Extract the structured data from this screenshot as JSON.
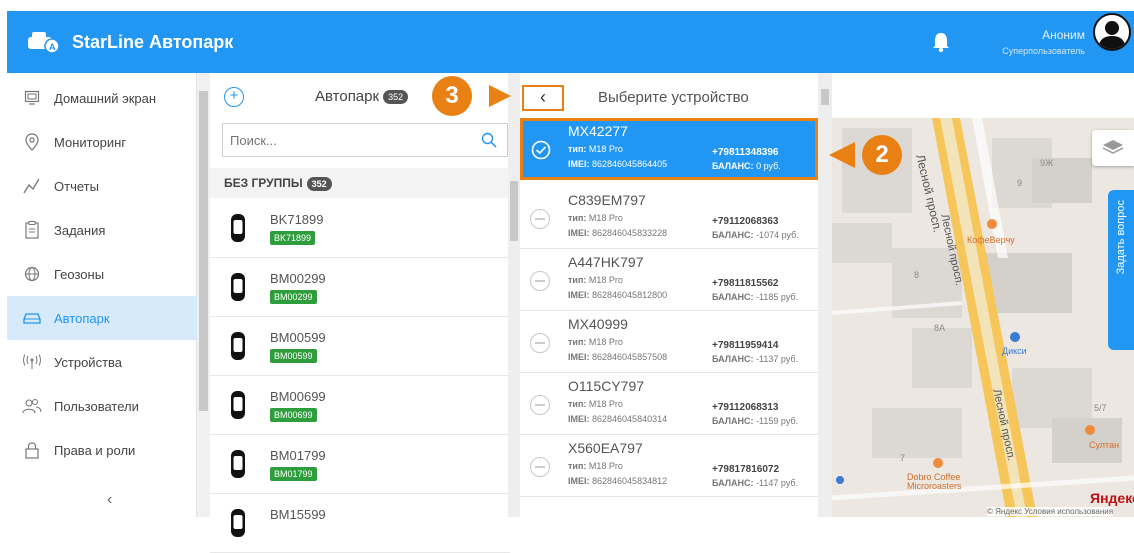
{
  "app": {
    "title": "StarLine Автопарк"
  },
  "user": {
    "name": "Аноним",
    "role": "Суперпользователь"
  },
  "sidebar": {
    "items": [
      {
        "label": "Домашний экран",
        "icon": "home-icon"
      },
      {
        "label": "Мониторинг",
        "icon": "location-pin-icon"
      },
      {
        "label": "Отчеты",
        "icon": "chart-icon"
      },
      {
        "label": "Задания",
        "icon": "clipboard-icon"
      },
      {
        "label": "Геозоны",
        "icon": "globe-icon"
      },
      {
        "label": "Автопарк",
        "icon": "car-icon",
        "active": true
      },
      {
        "label": "Устройства",
        "icon": "antenna-icon"
      },
      {
        "label": "Пользователи",
        "icon": "users-icon"
      },
      {
        "label": "Права и роли",
        "icon": "lock-icon"
      }
    ],
    "collapse_label": "‹"
  },
  "fleet": {
    "title": "Автопарк",
    "count": "352",
    "search_placeholder": "Поиск...",
    "group_label": "БЕЗ ГРУППЫ",
    "group_count": "352",
    "vehicles": [
      {
        "name": "BK71899",
        "plate": "BK71899"
      },
      {
        "name": "BM00299",
        "plate": "BM00299"
      },
      {
        "name": "BM00599",
        "plate": "BM00599"
      },
      {
        "name": "BM00699",
        "plate": "BM00699"
      },
      {
        "name": "BM01799",
        "plate": "BM01799"
      },
      {
        "name": "BM15599",
        "plate": ""
      }
    ]
  },
  "devices": {
    "title": "Выберите устройство",
    "back_label": "‹",
    "type_key": "тип:",
    "imei_key": "IMEI:",
    "balance_key": "БАЛАНС:",
    "list": [
      {
        "name": "MX42277",
        "type": "M18 Pro",
        "imei": "862846045864405",
        "phone": "+79811348396",
        "balance": "0 руб.",
        "selected": true
      },
      {
        "name": "C839EM797",
        "type": "M18 Pro",
        "imei": "862846045833228",
        "phone": "+79112068363",
        "balance": "-1074 руб."
      },
      {
        "name": "A447HK797",
        "type": "M18 Pro",
        "imei": "862846045812800",
        "phone": "+79811815562",
        "balance": "-1185 руб."
      },
      {
        "name": "MX40999",
        "type": "M18 Pro",
        "imei": "862846045857508",
        "phone": "+79811959414",
        "balance": "-1137 руб."
      },
      {
        "name": "O115CY797",
        "type": "M18 Pro",
        "imei": "862846045840314",
        "phone": "+79112068313",
        "balance": "-1159 руб."
      },
      {
        "name": "X560EA797",
        "type": "M18 Pro",
        "imei": "862846045834812",
        "phone": "+79817816072",
        "balance": "-1147 руб."
      }
    ]
  },
  "map": {
    "labels": {
      "street1": "Лесной просп.",
      "street2": "Лесной просп.",
      "street3": "Лесной просп.",
      "poi1": "КофеВерчу",
      "poi2": "Дикси",
      "poi3": "Султан",
      "poi4": "Dobro Coffee Microroasters",
      "house1": "9Ж",
      "house2": "9",
      "house3": "8",
      "house4": "8А",
      "house5": "5/7",
      "house6": "7",
      "copyright": "© Яндекс Условия использования",
      "brand": "Яндекс"
    },
    "ask_label": "Задать вопрос"
  },
  "callouts": {
    "c2": "2",
    "c3": "3"
  },
  "colors": {
    "primary": "#2196f3",
    "callout": "#e98014",
    "plate": "#2e9e3c"
  }
}
